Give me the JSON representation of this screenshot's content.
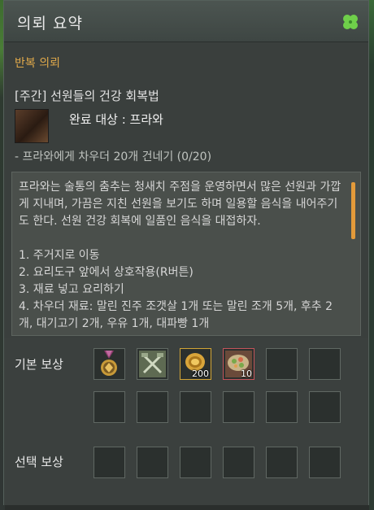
{
  "window": {
    "title": "의뢰 요약",
    "menu_icon": "clover-icon"
  },
  "quest": {
    "section_title": "반복 의뢰",
    "name": "[주간] 선원들의 건강 회복법",
    "completion_target": "완료 대상 : 프라와",
    "task": "- 프라와에게 차우더 20개 건네기 (0/20)",
    "description": "프라와는 술통의 춤추는 청새치 주점을 운영하면서 많은 선원과 가깝게 지내며, 가끔은 지친 선원을 보기도 하며 일용할 음식을 내어주기도 한다. 선원 건강 회복에 일품인 음식을 대접하자.\n\n1. 주거지로 이동\n2. 요리도구 앞에서 상호작용(R버튼)\n3. 재료 넣고 요리하기\n4. 차우더 재료: 말린 진주 조갯살 1개 또는 말린 조개 5개, 후추 2개, 대기고기 2개, 우유 1개, 대파빵 1개"
  },
  "rewards": {
    "basic_label": "기본 보상",
    "choice_label": "선택 보상",
    "basic_items": [
      {
        "icon": "medal-icon",
        "count": ""
      },
      {
        "icon": "crossed-tools-icon",
        "count": ""
      },
      {
        "icon": "gold-coin-icon",
        "count": "200"
      },
      {
        "icon": "food-dish-icon",
        "count": "10"
      }
    ]
  },
  "colors": {
    "section_title": "#e0a94a",
    "gold_border": "#d2a436",
    "red_border": "#c4545a",
    "scroll_thumb": "#e39a3a"
  }
}
